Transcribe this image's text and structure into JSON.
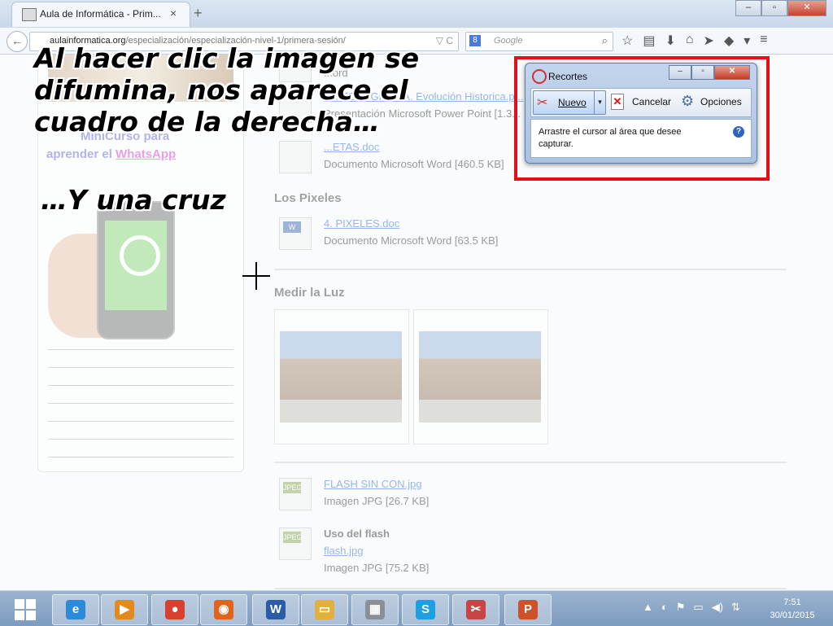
{
  "browser": {
    "tab_title": "Aula de Informática - Prim...",
    "tab_close": "×",
    "new_tab": "+",
    "window_buttons": {
      "minimize": "–",
      "maximize": "▫",
      "close": "✕"
    },
    "back": "←",
    "url_domain": "aulainformatica.org",
    "url_path": "/especialización/especialización-nivel-1/primera-sesión/",
    "url_icons": "▽ C",
    "search_engine_badge": "8",
    "search_placeholder": "Google",
    "search_go": "⌕",
    "toolbar_icons": [
      "☆",
      "▤",
      "⬇",
      "⌂",
      "➤",
      "◆",
      "▾",
      "≡"
    ]
  },
  "sidebar": {
    "title_line1": "MiniCurso para",
    "title_line2_prefix": "aprender el ",
    "title_link": "WhatsApp"
  },
  "content": {
    "files_top": [
      {
        "name": "",
        "desc": "...ord"
      },
      {
        "name": "01. FOTOGRAFÍA. Evolución Historica.p...",
        "desc": "Presentación Microsoft Power Point [1.3..."
      },
      {
        "name": "...ETAS.doc",
        "desc": "Documento Microsoft Word [460.5 KB]"
      }
    ],
    "section_pixeles": "Los Pixeles",
    "pixeles_file": {
      "name": "4. PIXELES.doc",
      "desc": "Documento Microsoft Word [63.5 KB]"
    },
    "section_luz": "Medir la Luz",
    "file_flash_sin": {
      "badge": "JPEG",
      "name": "FLASH SIN CON.jpg",
      "desc": "Imagen JPG [26.7 KB]"
    },
    "file_flash": {
      "badge": "JPEG",
      "title": "Uso del flash",
      "name": "flash.jpg",
      "desc": "Imagen JPG [75.2 KB]"
    },
    "word_badge": "W"
  },
  "overlay": {
    "line1": "Al hacer clic la imagen se",
    "line2": "difumina, nos aparece el",
    "line3": "cuadro de la derecha…",
    "sub": "…Y una cruz"
  },
  "snipping_tool": {
    "title": "Recortes",
    "new_label": "Nuevo",
    "dropdown": "▾",
    "cancel_label": "Cancelar",
    "options_label": "Opciones",
    "message": "Arrastre el cursor al área que desee capturar.",
    "help": "?",
    "buttons": {
      "minimize": "–",
      "maximize": "▫",
      "close": "✕"
    },
    "highlight_color": "#e3101a"
  },
  "taskbar": {
    "apps": [
      {
        "name": "ie",
        "glyph": "e",
        "color": "#2d8ad9"
      },
      {
        "name": "media-player",
        "glyph": "▶",
        "color": "#e28a1b"
      },
      {
        "name": "chrome",
        "glyph": "●",
        "color": "#d9412f"
      },
      {
        "name": "firefox",
        "glyph": "◉",
        "color": "#e0641b"
      },
      {
        "name": "word",
        "glyph": "W",
        "color": "#2b5ca8"
      },
      {
        "name": "explorer",
        "glyph": "▭",
        "color": "#e2b13c"
      },
      {
        "name": "calculator",
        "glyph": "▦",
        "color": "#8a8f96"
      },
      {
        "name": "skype",
        "glyph": "S",
        "color": "#1ca0e3"
      },
      {
        "name": "snipping-tool",
        "glyph": "✂",
        "color": "#c94444"
      },
      {
        "name": "powerpoint",
        "glyph": "P",
        "color": "#d0502b"
      }
    ],
    "tray_icons": [
      "▲",
      "◐",
      "⚑",
      "▭",
      "◀)",
      "⇅"
    ],
    "time": "7:51",
    "date": "30/01/2015"
  }
}
